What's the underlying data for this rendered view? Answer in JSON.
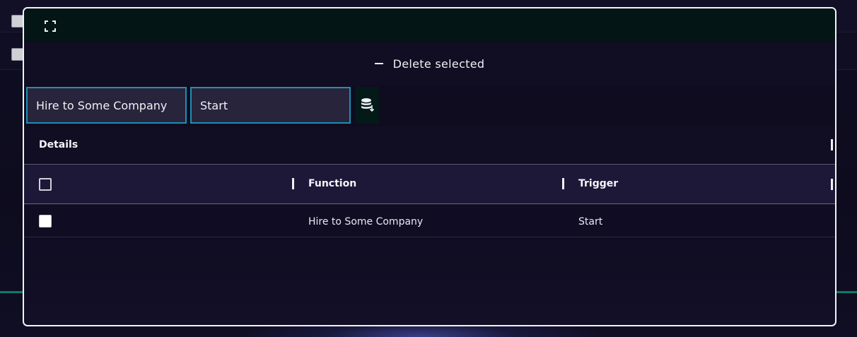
{
  "modal": {
    "delete_button_label": "Delete selected",
    "filters": {
      "function_value": "Hire to Some Company",
      "trigger_value": "Start"
    },
    "details_label": "Details",
    "table": {
      "columns": [
        "",
        "Function",
        "Trigger"
      ],
      "rows": [
        {
          "function": "Hire to Some Company",
          "trigger": "Start"
        }
      ]
    }
  },
  "icons": {
    "expand": "expand-icon",
    "minus": "minus-icon",
    "database_export": "database-export-icon"
  },
  "colors": {
    "accent_border": "#1f8fb3",
    "modal_border": "#f2f2f6",
    "header_bg": "#031514",
    "table_header_bg": "#1d1838"
  }
}
